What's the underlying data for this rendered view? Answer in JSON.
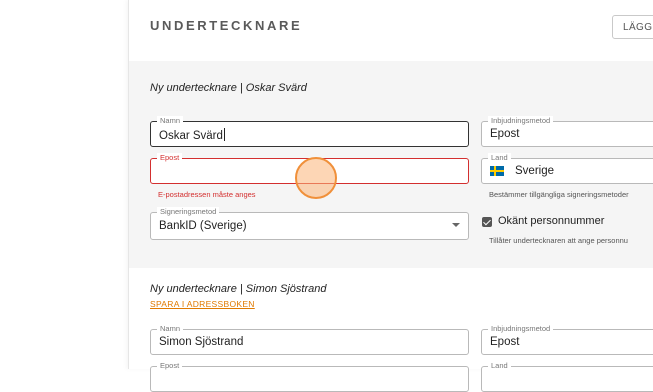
{
  "section": {
    "title": "UNDERTECKNARE",
    "add_button_label": "LÄGG T"
  },
  "signer1": {
    "heading": "Ny undertecknare | Oskar Svärd",
    "name": {
      "legend": "Namn",
      "value": "Oskar Svärd"
    },
    "invite": {
      "legend": "Inbjudningsmetod",
      "value": "Epost"
    },
    "email": {
      "legend": "Epost",
      "value": "",
      "error": "E-postadressen måste anges"
    },
    "country": {
      "legend": "Land",
      "value": "Sverige",
      "flag": "flag-sweden-icon",
      "helper": "Bestämmer tillgängliga signeringsmetoder"
    },
    "signing": {
      "legend": "Signeringsmetod",
      "value": "BankID (Sverige)"
    },
    "unknown_ssn": {
      "label": "Okänt personnummer",
      "checked": true,
      "helper": "Tillåter undertecknaren att ange personnu"
    }
  },
  "signer2": {
    "heading": "Ny undertecknare | Simon Sjöstrand",
    "save_link": "SPARA I ADRESSBOKEN",
    "name": {
      "legend": "Namn",
      "value": "Simon Sjöstrand"
    },
    "invite": {
      "legend": "Inbjudningsmetod",
      "value": "Epost"
    },
    "email": {
      "legend": "Epost"
    },
    "country": {
      "legend": "Land"
    }
  },
  "colors": {
    "accent": "#e07a00",
    "error": "#d32f2f",
    "block_bg": "#f5f5f5"
  }
}
